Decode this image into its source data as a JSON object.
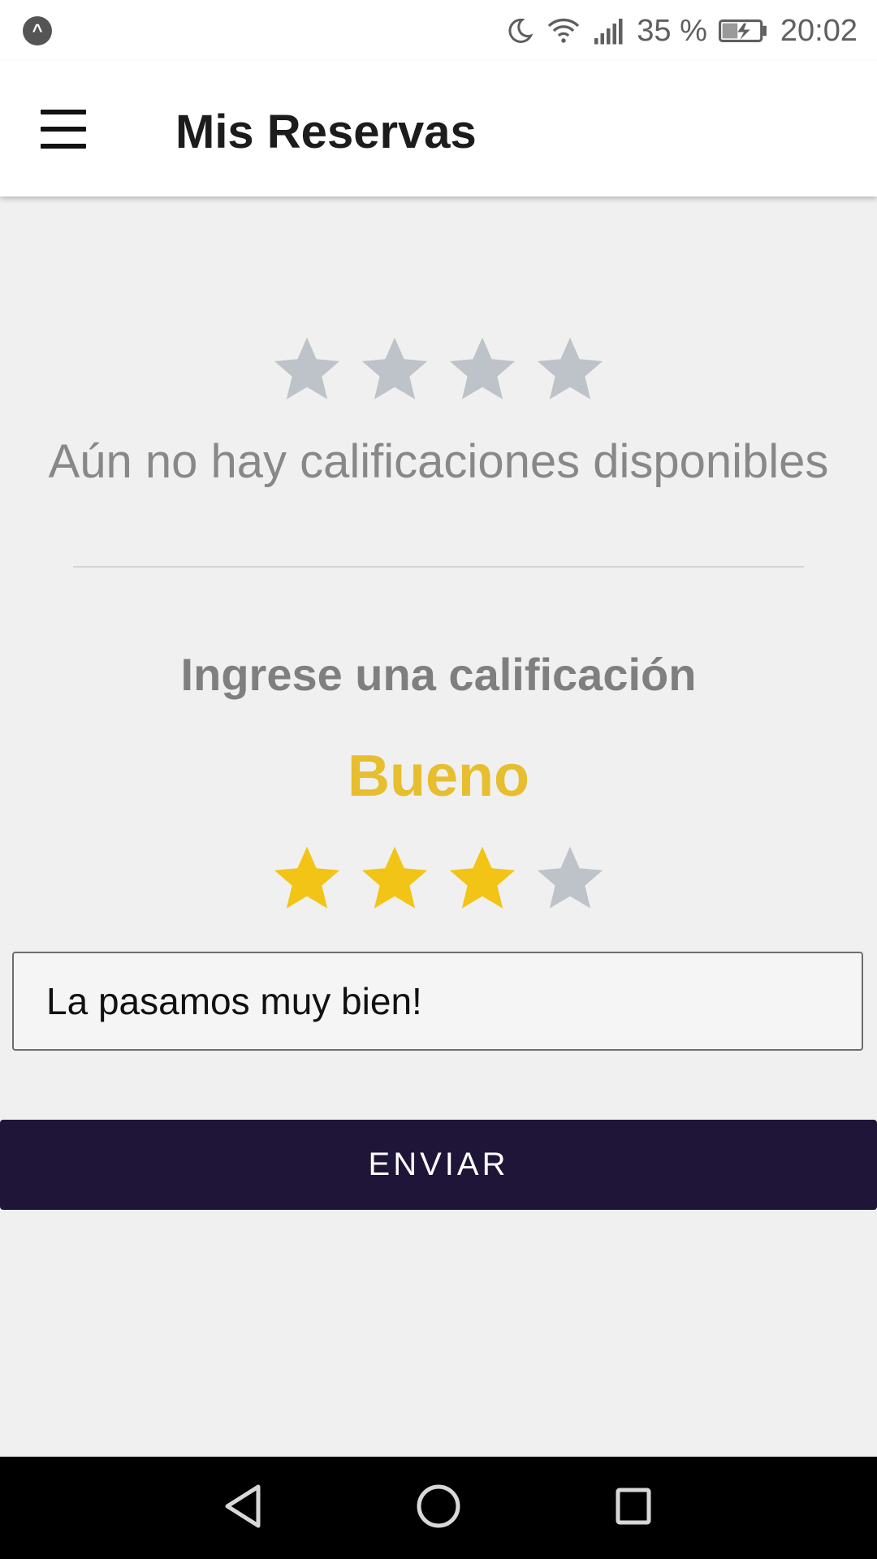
{
  "status_bar": {
    "app_icon": "app-launcher-icon",
    "icons": [
      "moon-icon",
      "wifi-icon",
      "signal-icon",
      "battery-charging-icon"
    ],
    "battery_percent": "35 %",
    "time": "20:02"
  },
  "app_bar": {
    "menu_icon": "hamburger-menu-icon",
    "title": "Mis Reservas"
  },
  "existing_ratings": {
    "star_count": 4,
    "empty_message": "Aún no hay calificaciones disponibles"
  },
  "new_rating": {
    "heading": "Ingrese una calificación",
    "rating_label": "Bueno",
    "selected_stars": 3,
    "max_stars": 4,
    "comment_value": "La pasamos muy bien!",
    "submit_label": "ENVIAR"
  },
  "colors": {
    "star_active": "#f2c415",
    "star_inactive": "#bdc3c8",
    "rating_label": "#e6be2e",
    "submit_background": "#1f1538"
  },
  "nav_bar": {
    "icons": [
      "back-icon",
      "home-icon",
      "recents-icon"
    ]
  }
}
